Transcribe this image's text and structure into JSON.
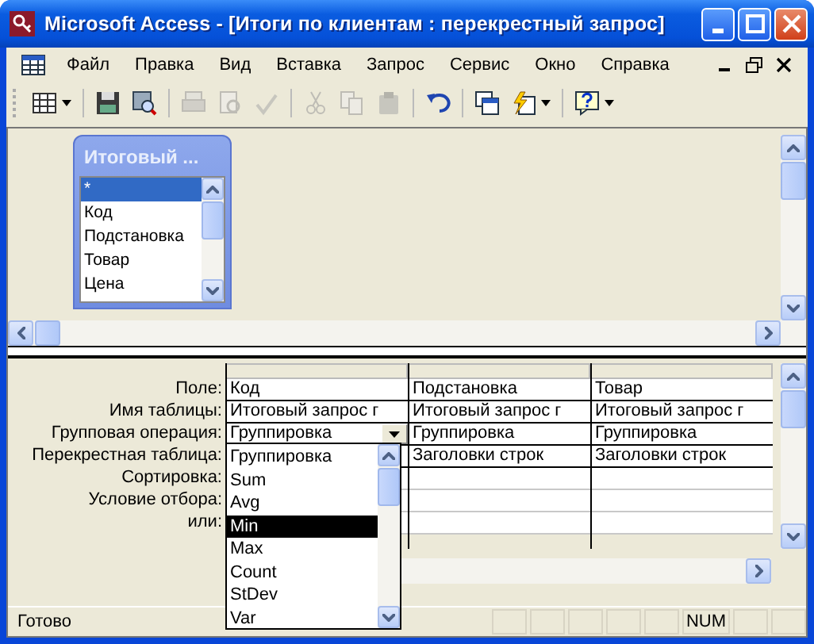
{
  "window": {
    "title": "Microsoft Access - [Итоги по клиентам : перекрестный запрос]"
  },
  "menu": [
    "Файл",
    "Правка",
    "Вид",
    "Вставка",
    "Запрос",
    "Сервис",
    "Окно",
    "Справка"
  ],
  "toolbar": [
    {
      "kind": "view",
      "disabled": false
    },
    {
      "kind": "save",
      "disabled": false
    },
    {
      "kind": "search",
      "disabled": false
    },
    {
      "kind": "print",
      "disabled": true
    },
    {
      "kind": "preview",
      "disabled": true
    },
    {
      "kind": "spelling",
      "disabled": true
    },
    {
      "kind": "cut",
      "disabled": true
    },
    {
      "kind": "copy",
      "disabled": true
    },
    {
      "kind": "paste",
      "disabled": true
    },
    {
      "kind": "undo",
      "disabled": false
    },
    {
      "kind": "properties",
      "disabled": false
    },
    {
      "kind": "build",
      "disabled": false
    },
    {
      "kind": "help",
      "disabled": false
    }
  ],
  "table_box": {
    "title": "Итоговый ...",
    "fields": [
      {
        "name": "*",
        "selected": true
      },
      {
        "name": "Код",
        "selected": false
      },
      {
        "name": "Подстановка",
        "selected": false
      },
      {
        "name": "Товар",
        "selected": false
      },
      {
        "name": "Цена",
        "selected": false
      }
    ]
  },
  "grid": {
    "row_labels": [
      "Поле:",
      "Имя таблицы:",
      "Групповая операция:",
      "Перекрестная таблица:",
      "Сортировка:",
      "Условие отбора:",
      "или:"
    ],
    "columns": [
      {
        "field": "Код",
        "table": "Итоговый запрос г",
        "total": "Группировка"
      },
      {
        "field": "Подстановка",
        "table": "Итоговый запрос г",
        "total": "Группировка",
        "crosstab": "Заголовки строк"
      },
      {
        "field": "Товар",
        "table": "Итоговый запрос г",
        "total": "Группировка",
        "crosstab": "Заголовки строк"
      }
    ]
  },
  "dropdown": {
    "items": [
      {
        "label": "Группировка",
        "selected": false
      },
      {
        "label": "Sum",
        "selected": false
      },
      {
        "label": "Avg",
        "selected": false
      },
      {
        "label": "Min",
        "selected": true
      },
      {
        "label": "Max",
        "selected": false
      },
      {
        "label": "Count",
        "selected": false
      },
      {
        "label": "StDev",
        "selected": false
      },
      {
        "label": "Var",
        "selected": false
      }
    ]
  },
  "status_bar": {
    "text": "Готово",
    "indicator": "NUM"
  }
}
